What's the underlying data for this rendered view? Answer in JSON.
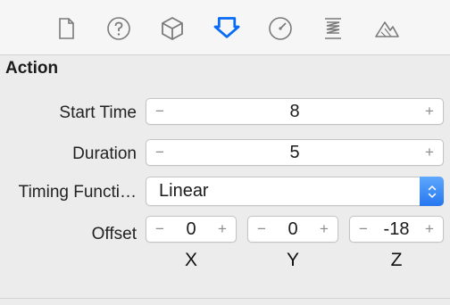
{
  "toolbar": {
    "items": [
      {
        "icon": "file-inspector-icon",
        "selected": false
      },
      {
        "icon": "quick-help-icon",
        "selected": false
      },
      {
        "icon": "node-inspector-icon",
        "selected": false
      },
      {
        "icon": "action-inspector-icon",
        "selected": true
      },
      {
        "icon": "attributes-inspector-icon",
        "selected": false
      },
      {
        "icon": "physics-inspector-icon",
        "selected": false
      },
      {
        "icon": "terrain-inspector-icon",
        "selected": false
      }
    ],
    "accent_color": "#0a6cf5",
    "icon_color": "#7a7a7a"
  },
  "section": {
    "title": "Action"
  },
  "fields": {
    "start_time": {
      "label": "Start Time",
      "value": "8",
      "minus": "−",
      "plus": "+"
    },
    "duration": {
      "label": "Duration",
      "value": "5",
      "minus": "−",
      "plus": "+"
    },
    "timing_function": {
      "label": "Timing Functi…",
      "value": "Linear"
    },
    "offset": {
      "label": "Offset",
      "x": {
        "value": "0",
        "axis": "X"
      },
      "y": {
        "value": "0",
        "axis": "Y"
      },
      "z": {
        "value": "-18",
        "axis": "Z"
      },
      "minus": "−",
      "plus": "+"
    }
  }
}
